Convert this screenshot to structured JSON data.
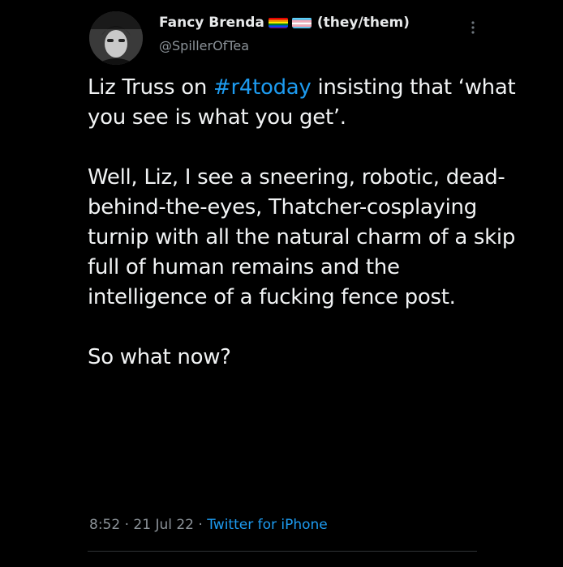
{
  "tweet": {
    "author": {
      "display_name": "Fancy Brenda",
      "pronouns": "(they/them)",
      "handle": "@SpillerOfTea",
      "flags": [
        "rainbow-pride-flag",
        "transgender-flag"
      ]
    },
    "body": {
      "line1_before": "Liz Truss on ",
      "hashtag": "#r4today",
      "line1_after": " insisting that ‘what you see is what you get’.",
      "paragraph2": "Well, Liz, I see a sneering, robotic, dead-behind-the-eyes, Thatcher-cosplaying turnip with all the natural charm of a skip full of human remains and the intelligence of a fucking fence post.",
      "paragraph3": "So what now?"
    },
    "meta": {
      "time": "8:52",
      "separator": " · ",
      "date": "21 Jul 22",
      "source": "Twitter for iPhone"
    },
    "icons": {
      "more": "more-vertical-icon"
    },
    "colors": {
      "background": "#000000",
      "text": "#e7e9ea",
      "secondary": "#8b9298",
      "link": "#1d9bf0"
    }
  }
}
